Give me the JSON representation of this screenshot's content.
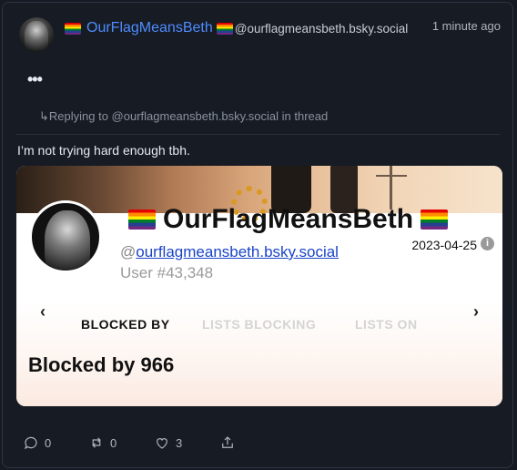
{
  "post": {
    "display_name": "OurFlagMeansBeth",
    "handle": "@ourflagmeansbeth.bsky.social",
    "time": "1 minute ago",
    "more_label": "•••",
    "reply_prefix": "↳",
    "reply_text": "Replying to @ourflagmeansbeth.bsky.social in thread",
    "text": "I’m not trying hard enough tbh."
  },
  "card": {
    "name": "OurFlagMeansBeth",
    "handle_prefix": "@",
    "handle": "ourflagmeansbeth.bsky.social",
    "date": "2023-04-25",
    "info": "i",
    "user_number": "User #43,348",
    "prev": "‹",
    "next": "›",
    "tabs": [
      "BLOCKED BY",
      "LISTS BLOCKING",
      "LISTS ON"
    ],
    "blocked_count": "Blocked by 966"
  },
  "actions": {
    "reply_count": "0",
    "repost_count": "0",
    "like_count": "3"
  },
  "colors": {
    "background": "#171b24",
    "link": "#4d8cff"
  },
  "icons": [
    "rainbow-flag-icon",
    "reply-icon",
    "repost-icon",
    "heart-icon",
    "share-icon",
    "info-icon",
    "chevron-left-icon",
    "chevron-right-icon"
  ]
}
